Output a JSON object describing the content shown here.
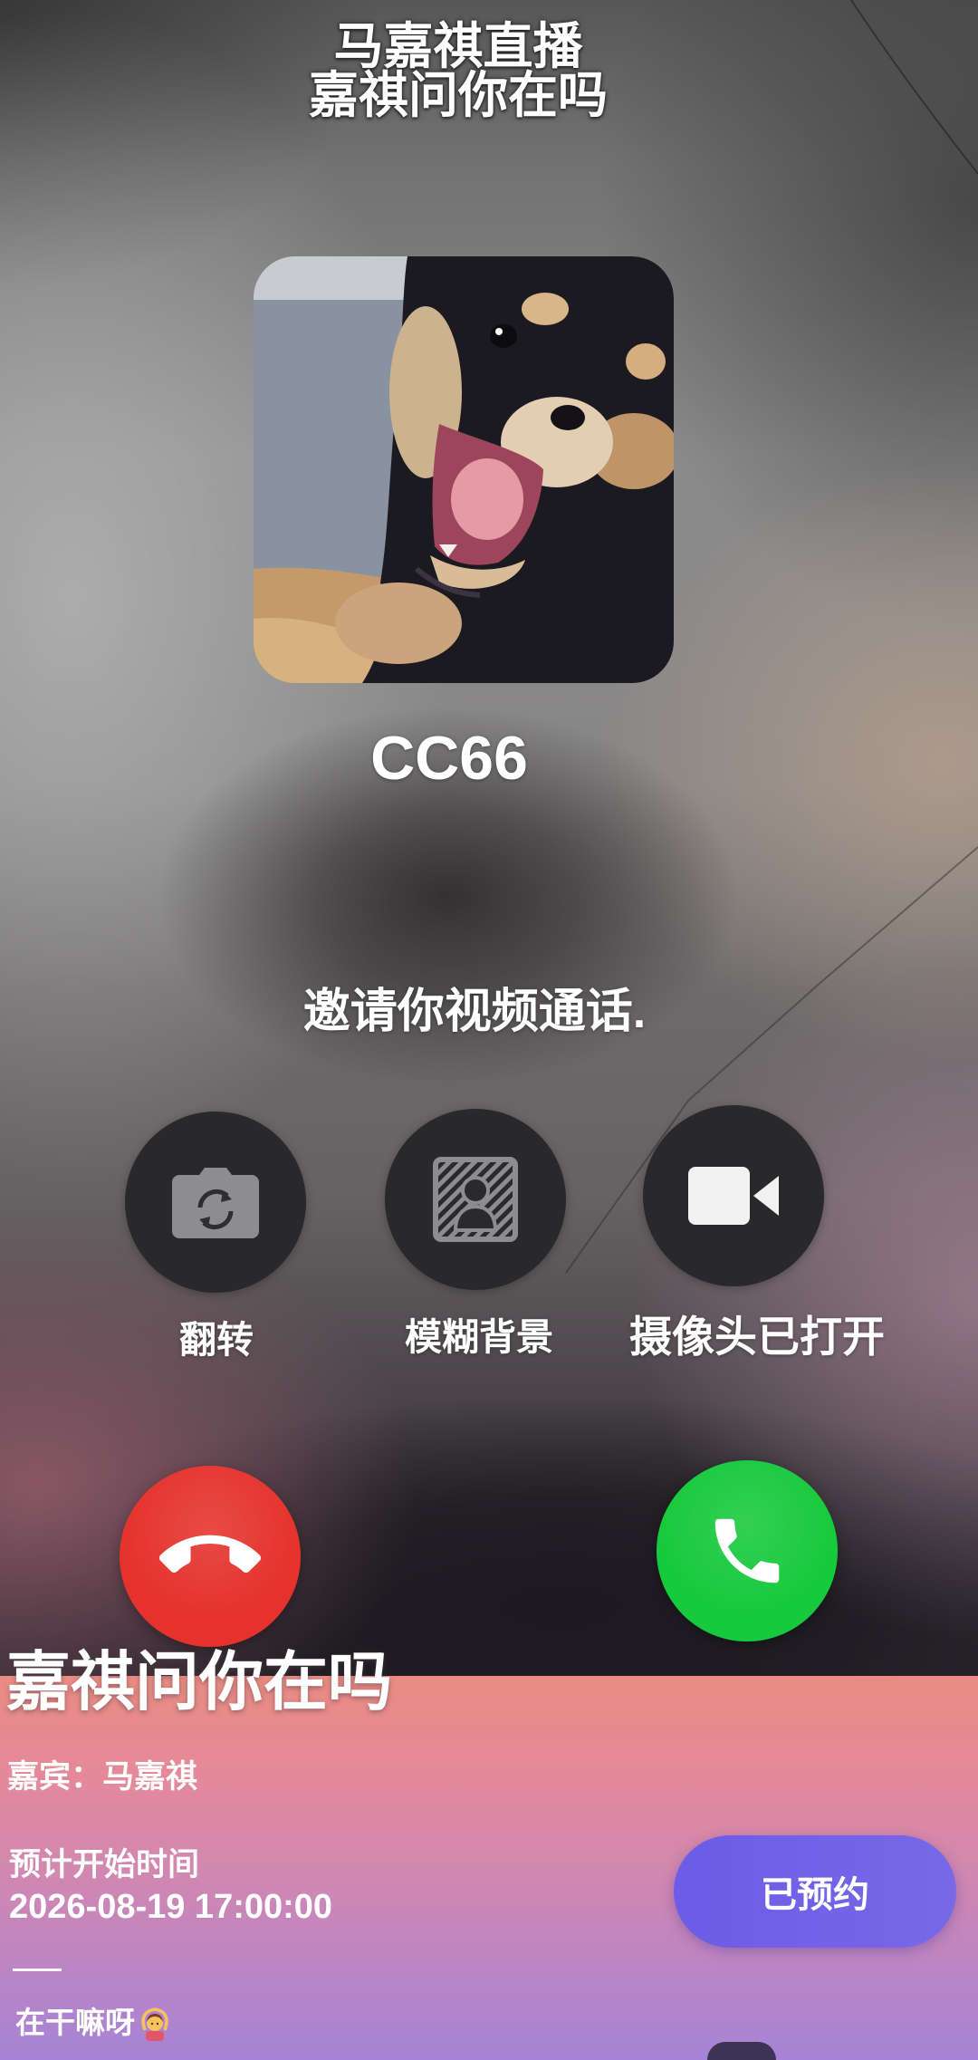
{
  "live_header": {
    "title": "马嘉祺直播",
    "subtitle": "嘉祺问你在吗"
  },
  "caller": {
    "name": "CC66",
    "avatar": "dog-photo-avatar"
  },
  "invite_message": "邀请你视频通话.",
  "controls": [
    {
      "label": "翻转",
      "icon": "flip-camera-icon"
    },
    {
      "label": "模糊背景",
      "icon": "blur-background-icon"
    },
    {
      "label": "摄像头已打开",
      "icon": "video-camera-icon"
    }
  ],
  "call_actions": {
    "decline_icon": "hang-up-icon",
    "accept_icon": "phone-icon"
  },
  "live_card": {
    "title": "嘉祺问你在吗",
    "guest": "嘉宾：马嘉祺",
    "start_time_label": "预计开始时间",
    "start_time": "2026-08-19 17:00:00",
    "reserve_button": "已预约",
    "comment": "在干嘛呀",
    "comment_emoji_icon": "person-gesturing-emoji-icon"
  },
  "colors": {
    "control_button": "#29292b",
    "decline": "#e5322c",
    "accept": "#17c93c",
    "reserve_button": "#6c5ce6",
    "card_top": "#ea8c82",
    "card_bottom": "#a683d6"
  }
}
